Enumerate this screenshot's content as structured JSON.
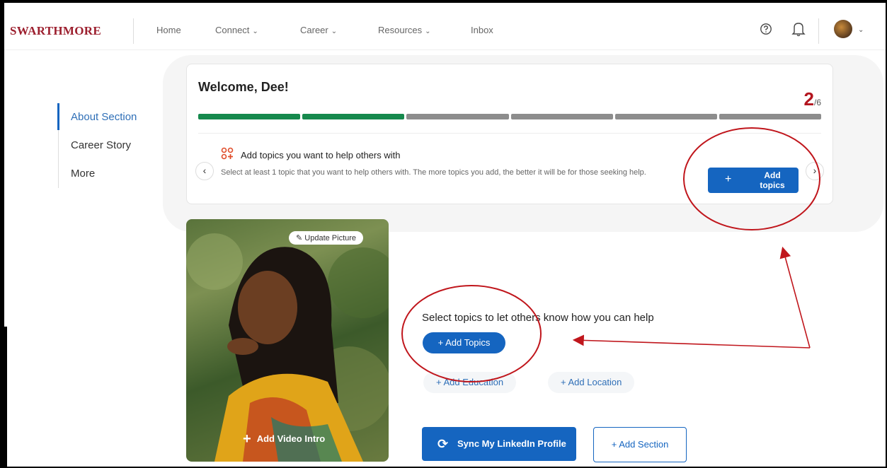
{
  "header": {
    "brand": "SWARTHMORE",
    "nav": [
      {
        "label": "Home",
        "has_chevron": false
      },
      {
        "label": "Connect",
        "has_chevron": true
      },
      {
        "label": "Career",
        "has_chevron": true
      },
      {
        "label": "Resources",
        "has_chevron": true
      },
      {
        "label": "Inbox",
        "has_chevron": false
      }
    ],
    "chevron_glyph": "⌄",
    "icons": [
      "help-icon",
      "bell-icon",
      "avatar"
    ]
  },
  "sidebar": {
    "items": [
      {
        "label": "About Section",
        "active": true
      },
      {
        "label": "Career Story",
        "active": false
      },
      {
        "label": "More",
        "active": false
      }
    ]
  },
  "welcome": {
    "title": "Welcome, Dee!",
    "completed": "2",
    "total": "/6",
    "progress": {
      "completed_segments": 2,
      "total_segments": 6
    },
    "tip": {
      "title": "Add topics you want to help others with",
      "description": "Select at least 1 topic that you want to help others with. The more topics you add, the better it will be for those seeking help.",
      "button_label": "Add topics",
      "prev_glyph": "‹",
      "next_glyph": "›"
    }
  },
  "profile": {
    "update_picture": "Update Picture",
    "add_video_intro": "Add Video Intro",
    "help_title": "Select topics to let others know how you can help",
    "add_topics": "+ Add Topics",
    "add_education": "+ Add Education",
    "add_location": "+ Add Location",
    "sync_linkedin": "Sync My LinkedIn Profile",
    "add_section": "+ Add Section"
  },
  "colors": {
    "brand": "#9c1f2e",
    "primary": "#1565c0",
    "progress_done": "#16894d",
    "progress_todo": "#8d8d8d",
    "annotation": "#c0161c"
  }
}
